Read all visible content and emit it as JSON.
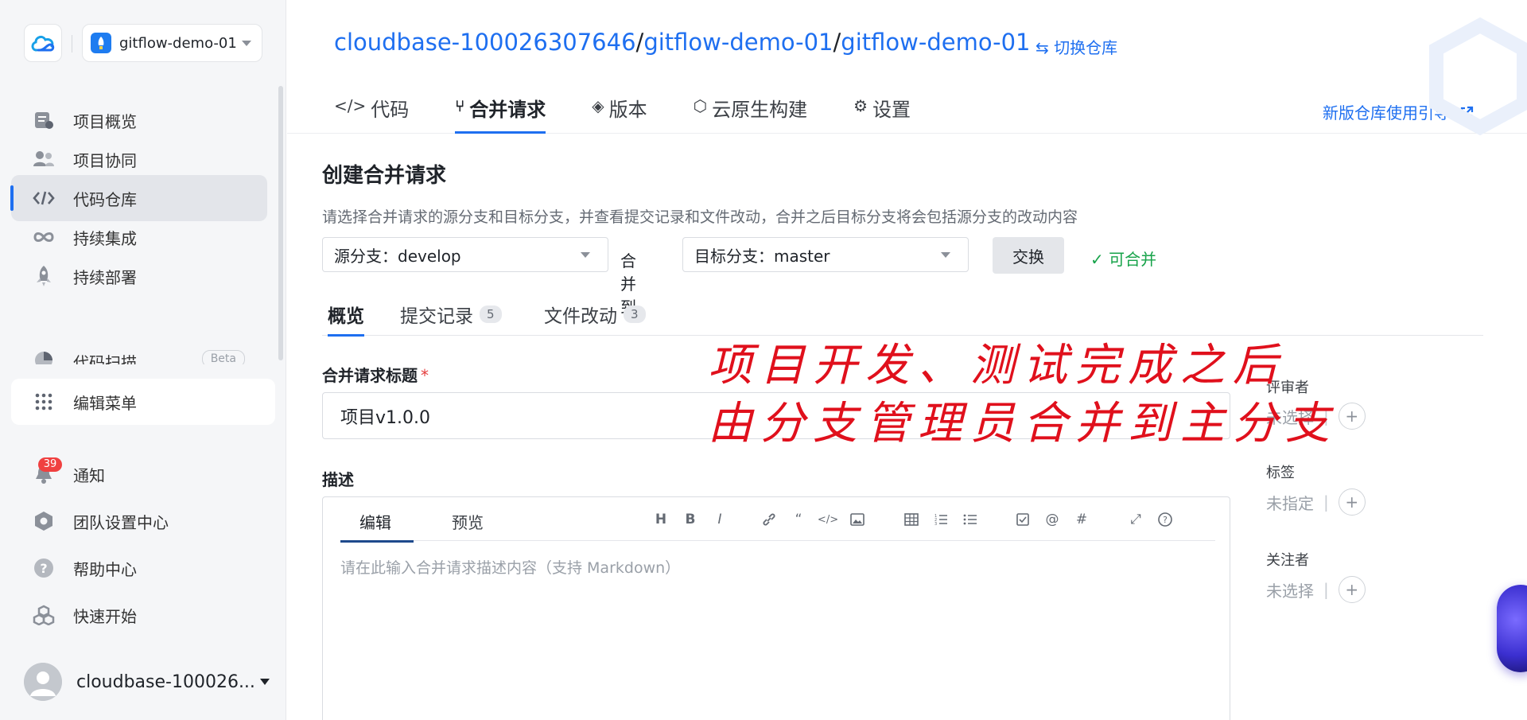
{
  "sidebar": {
    "repo_name": "gitflow-demo-01",
    "items": [
      {
        "label": "项目概览",
        "icon": "overview-icon"
      },
      {
        "label": "项目协同",
        "icon": "people-icon"
      },
      {
        "label": "代码仓库",
        "icon": "code-icon"
      },
      {
        "label": "持续集成",
        "icon": "infinity-icon"
      },
      {
        "label": "持续部署",
        "icon": "rocket-icon"
      },
      {
        "label": "代码扫描",
        "icon": "pie-icon",
        "badge": "Beta"
      }
    ],
    "edit_menu": "编辑菜单",
    "bottom_items": [
      {
        "label": "通知",
        "icon": "bell-icon",
        "badge": "39"
      },
      {
        "label": "团队设置中心",
        "icon": "gear-hex-icon"
      },
      {
        "label": "帮助中心",
        "icon": "help-icon"
      },
      {
        "label": "快速开始",
        "icon": "cubes-icon"
      }
    ],
    "user_name": "cloudbase-100026..."
  },
  "header": {
    "path_org": "cloudbase-100026307646",
    "path_group": "gitflow-demo-01",
    "path_repo": "gitflow-demo-01",
    "switch_repo": "⇆ 切换仓库",
    "tabs": [
      {
        "icon": "</>",
        "label": "代码"
      },
      {
        "icon": "⑂",
        "label": "合并请求"
      },
      {
        "icon": "◈",
        "label": "版本"
      },
      {
        "icon": "⬡",
        "label": "云原生构建"
      },
      {
        "icon": "⚙",
        "label": "设置"
      }
    ],
    "guide_link": "新版仓库使用引导"
  },
  "form": {
    "title": "创建合并请求",
    "description": "请选择合并请求的源分支和目标分支，并查看提交记录和文件改动，合并之后目标分支将会包括源分支的改动内容",
    "source_branch": "源分支：develop",
    "merge_to": "合并到",
    "target_branch": "目标分支：master",
    "swap": "交换",
    "mergeable": "✓ 可合并",
    "subtabs": [
      {
        "label": "概览"
      },
      {
        "label": "提交记录",
        "count": "5"
      },
      {
        "label": "文件改动",
        "count": "3"
      }
    ],
    "title_label": "合并请求标题",
    "required_mark": "*",
    "title_value": "项目v1.0.0",
    "desc_label": "描述",
    "editor_tabs": [
      "编辑",
      "预览"
    ],
    "editor_placeholder": "请在此输入合并请求描述内容（支持 Markdown）",
    "toolbar": [
      "H",
      "B",
      "I",
      "🔗",
      "“",
      "</>",
      "▣",
      "⊞",
      "≔",
      "☰",
      "☑",
      "@",
      "#",
      "⤢",
      "?"
    ]
  },
  "right_panel": {
    "reviewers_label": "评审者",
    "reviewers_value": "未选择",
    "tags_label": "标签",
    "tags_value": "未指定",
    "watchers_label": "关注者",
    "watchers_value": "未选择"
  },
  "annotation": {
    "line1": "项目开发、测试完成之后",
    "line2": "由分支管理员合并到主分支"
  },
  "colors": {
    "accent": "#1e6ff0",
    "success": "#17a34a",
    "annotation": "#e0101c",
    "badge": "#f04040"
  }
}
